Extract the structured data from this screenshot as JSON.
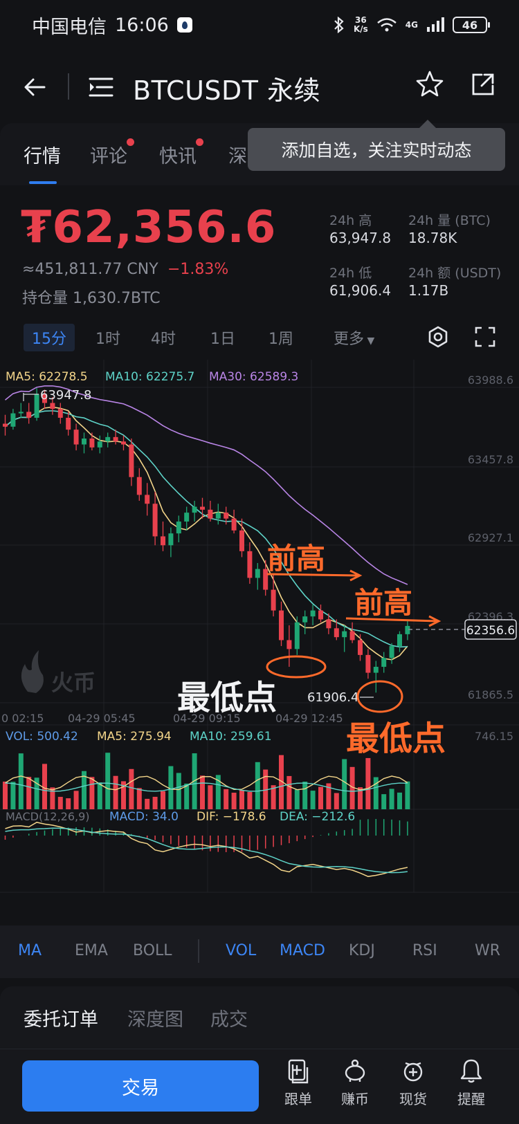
{
  "status_bar": {
    "carrier": "中国电信",
    "time": "16:06",
    "network_speed_top": "36",
    "network_speed_bottom": "K/s",
    "signal_label": "4G",
    "battery": "46"
  },
  "nav": {
    "title": "BTCUSDT 永续",
    "icons": [
      "back-arrow-icon",
      "menu-icon",
      "star-icon",
      "share-icon"
    ]
  },
  "tabs": [
    {
      "label": "行情",
      "active": true,
      "dot": false
    },
    {
      "label": "评论",
      "active": false,
      "dot": true
    },
    {
      "label": "快讯",
      "active": false,
      "dot": true
    },
    {
      "label": "深",
      "active": false,
      "dot": false
    }
  ],
  "tooltip": "添加自选，关注实时动态",
  "price": {
    "main": "₮62,356.6",
    "cny": "≈451,811.77 CNY",
    "change": "−1.83%",
    "holding": "持仓量 1,630.7BTC"
  },
  "stats": {
    "high_label": "24h 高",
    "high_value": "63,947.8",
    "vol_label": "24h 量 (BTC)",
    "vol_value": "18.78K",
    "low_label": "24h 低",
    "low_value": "61,906.4",
    "amount_label": "24h 额 (USDT)",
    "amount_value": "1.17B"
  },
  "timeframes": [
    "15分",
    "1时",
    "4时",
    "1日",
    "1周"
  ],
  "more_label": "更多",
  "chart": {
    "ma5_label": "MA5: 62278.5",
    "ma10_label": "MA10: 62275.7",
    "ma30_label": "MA30: 62589.3",
    "price_levels": [
      "63988.6",
      "63457.8",
      "62927.1",
      "62396.3",
      "61865.5"
    ],
    "current_price_tag": "62356.6",
    "high_marker": "63947.8",
    "low_marker": "61906.4",
    "time_labels": [
      "0 02:15",
      "04-29 05:45",
      "04-29 09:15",
      "04-29 12:45"
    ],
    "annotations": {
      "prev_high_1": "前高",
      "prev_high_2": "前高",
      "lowest_1": "最低点",
      "lowest_2": "最低点"
    },
    "watermark": "火币",
    "vol_label": "VOL: 500.42",
    "vol_ma5_label": "MA5: 275.94",
    "vol_ma10_label": "MA10: 259.61",
    "vol_max": "746.15",
    "macd_params": "MACD(12,26,9)",
    "macd_label": "MACD: 34.0",
    "dif_label": "DIF: −178.6",
    "dea_label": "DEA: −212.6",
    "colors": {
      "up": "#1fa774",
      "down": "#e8414d",
      "ma5": "#f3d58a",
      "ma10": "#5ed3c8",
      "ma30": "#b985e6",
      "annotation": "#ff6a2b"
    }
  },
  "indicators": [
    {
      "label": "MA",
      "active": true
    },
    {
      "label": "EMA",
      "active": false
    },
    {
      "label": "BOLL",
      "active": false
    },
    {
      "label": "VOL",
      "active": true
    },
    {
      "label": "MACD",
      "active": true
    },
    {
      "label": "KDJ",
      "active": false
    },
    {
      "label": "RSI",
      "active": false
    },
    {
      "label": "WR",
      "active": false
    }
  ],
  "order_tabs": [
    {
      "label": "委托订单",
      "active": true
    },
    {
      "label": "深度图",
      "active": false
    },
    {
      "label": "成交",
      "active": false
    }
  ],
  "bottom": {
    "trade_label": "交易",
    "items": [
      {
        "label": "跟单",
        "icon": "copy-trade-icon"
      },
      {
        "label": "赚币",
        "icon": "piggy-bank-icon"
      },
      {
        "label": "现货",
        "icon": "spot-icon"
      },
      {
        "label": "提醒",
        "icon": "bell-icon"
      }
    ]
  },
  "candles": [
    [
      63720,
      63780,
      63640,
      63700
    ],
    [
      63700,
      63820,
      63680,
      63790
    ],
    [
      63790,
      63860,
      63760,
      63800
    ],
    [
      63800,
      63860,
      63720,
      63760
    ],
    [
      63760,
      63960,
      63740,
      63920
    ],
    [
      63920,
      63950,
      63820,
      63860
    ],
    [
      63860,
      63900,
      63780,
      63820
    ],
    [
      63820,
      63860,
      63720,
      63760
    ],
    [
      63760,
      63800,
      63640,
      63680
    ],
    [
      63680,
      63720,
      63540,
      63580
    ],
    [
      63580,
      63660,
      63520,
      63620
    ],
    [
      63620,
      63660,
      63540,
      63560
    ],
    [
      63560,
      63640,
      63520,
      63600
    ],
    [
      63600,
      63660,
      63560,
      63630
    ],
    [
      63630,
      63680,
      63580,
      63600
    ],
    [
      63600,
      63640,
      63540,
      63580
    ],
    [
      63580,
      63620,
      63300,
      63360
    ],
    [
      63360,
      63420,
      63200,
      63240
    ],
    [
      63240,
      63320,
      63100,
      63180
    ],
    [
      63180,
      63260,
      62900,
      62960
    ],
    [
      62960,
      63060,
      62860,
      62900
    ],
    [
      62900,
      63020,
      62820,
      62980
    ],
    [
      62980,
      63100,
      62920,
      63060
    ],
    [
      63060,
      63160,
      63000,
      63120
    ],
    [
      63120,
      63200,
      63060,
      63160
    ],
    [
      63160,
      63220,
      63080,
      63140
    ],
    [
      63140,
      63200,
      63060,
      63080
    ],
    [
      63080,
      63180,
      63040,
      63120
    ],
    [
      63120,
      63160,
      63040,
      63080
    ],
    [
      63080,
      63140,
      62980,
      63000
    ],
    [
      63000,
      63080,
      62820,
      62860
    ],
    [
      62860,
      62920,
      62640,
      62680
    ],
    [
      62680,
      62780,
      62600,
      62740
    ],
    [
      62740,
      62800,
      62560,
      62600
    ],
    [
      62600,
      62700,
      62420,
      62460
    ],
    [
      62460,
      62520,
      62220,
      62260
    ],
    [
      62260,
      62360,
      62080,
      62200
    ],
    [
      62200,
      62420,
      62160,
      62380
    ],
    [
      62380,
      62460,
      62300,
      62420
    ],
    [
      62420,
      62500,
      62360,
      62460
    ],
    [
      62460,
      62500,
      62380,
      62400
    ],
    [
      62400,
      62440,
      62300,
      62340
    ],
    [
      62340,
      62400,
      62260,
      62280
    ],
    [
      62280,
      62360,
      62180,
      62320
    ],
    [
      62320,
      62380,
      62240,
      62260
    ],
    [
      62260,
      62300,
      62120,
      62160
    ],
    [
      62160,
      62200,
      62000,
      62040
    ],
    [
      62040,
      62120,
      61906,
      62080
    ],
    [
      62080,
      62180,
      62040,
      62140
    ],
    [
      62140,
      62240,
      62100,
      62220
    ],
    [
      62220,
      62320,
      62180,
      62300
    ],
    [
      62300,
      62400,
      62260,
      62356
    ]
  ]
}
